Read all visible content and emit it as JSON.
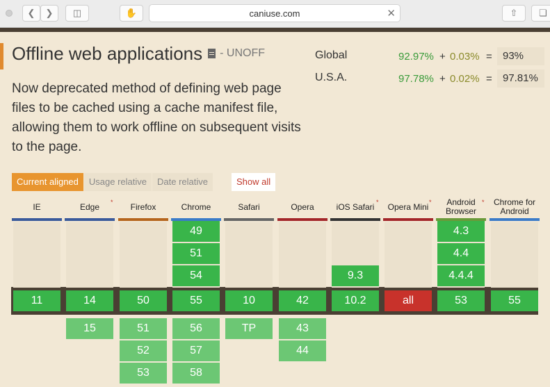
{
  "browser": {
    "url": "caniuse.com"
  },
  "header": {
    "title": "Offline web applications",
    "status": "- UNOFF",
    "description": "Now deprecated method of defining web page files to be cached using a cache manifest file, allowing them to work offline on subsequent visits to the page."
  },
  "stats": [
    {
      "label": "Global",
      "supported": "92.97%",
      "plus": "+",
      "partial": "0.03%",
      "eq": "=",
      "total": "93%"
    },
    {
      "label": "U.S.A.",
      "supported": "97.78%",
      "plus": "+",
      "partial": "0.02%",
      "eq": "=",
      "total": "97.81%"
    }
  ],
  "tabs": [
    "Current aligned",
    "Usage relative",
    "Date relative"
  ],
  "show_all": "Show all",
  "columns": [
    {
      "name": "IE",
      "color": "#3a5a9b",
      "star": false,
      "past": [],
      "current": "11",
      "future": []
    },
    {
      "name": "Edge",
      "color": "#3a5a9b",
      "star": true,
      "past": [],
      "current": "14",
      "future": [
        "15"
      ]
    },
    {
      "name": "Firefox",
      "color": "#b5651d",
      "star": false,
      "past": [],
      "current": "50",
      "future": [
        "51",
        "52",
        "53"
      ]
    },
    {
      "name": "Chrome",
      "color": "#3b7bc8",
      "star": false,
      "past": [
        "49",
        "51",
        "54"
      ],
      "current": "55",
      "future": [
        "56",
        "57",
        "58"
      ]
    },
    {
      "name": "Safari",
      "color": "#666666",
      "star": false,
      "past": [],
      "current": "10",
      "future": [
        "TP"
      ]
    },
    {
      "name": "Opera",
      "color": "#a3262a",
      "star": false,
      "past": [],
      "current": "42",
      "future": [
        "43",
        "44"
      ]
    },
    {
      "name": "iOS Safari",
      "color": "#333333",
      "star": true,
      "past": [
        "9.3"
      ],
      "current": "10.2",
      "future": []
    },
    {
      "name": "Opera Mini",
      "color": "#a3262a",
      "star": true,
      "past": [],
      "current": "all",
      "current_status": "unsupported",
      "future": []
    },
    {
      "name": "Android Browser",
      "color": "#6a9a3a",
      "star": true,
      "past": [
        "4.3",
        "4.4",
        "4.4.4"
      ],
      "current": "53",
      "future": []
    },
    {
      "name": "Chrome for Android",
      "color": "#3b7bc8",
      "star": false,
      "past": [],
      "current": "55",
      "future": []
    }
  ]
}
